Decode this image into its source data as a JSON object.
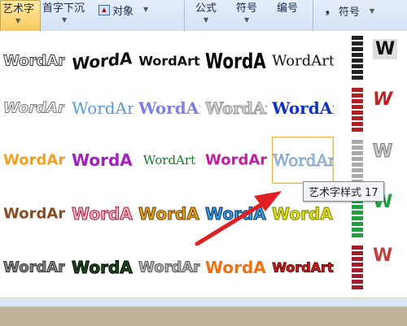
{
  "ribbon": {
    "wordart_btn": "艺术字",
    "dropcap_btn": "首字下沉",
    "object_btn": "对象",
    "formula_btn": "公式",
    "symbol_btn": "符号",
    "number_btn": "编号",
    "symbol2_btn": "符号"
  },
  "gallery": {
    "wordart_text": "WordArt",
    "tooltip": "艺术字样式 17",
    "highlighted_style": 17,
    "colors": {
      "selection": "#f8c85a",
      "arrow": "#e02020"
    }
  }
}
